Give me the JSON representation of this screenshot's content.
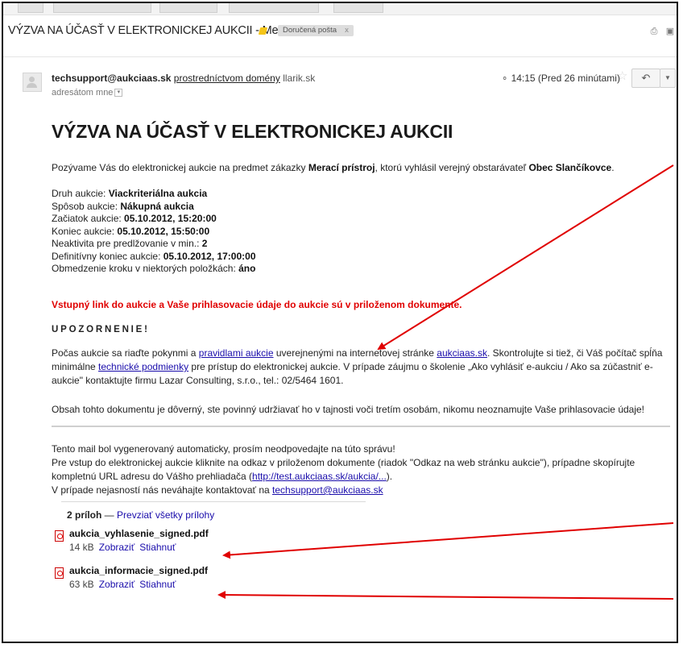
{
  "email": {
    "subject": "VÝZVA NA ÚČASŤ V ELEKTRONICKEJ AUKCII - Merací prístroj",
    "label": "Doručená pošta",
    "label_close": "x",
    "sender": "techsupport@aukciaas.sk",
    "via_text": "prostredníctvom domény",
    "via_domain": "llarik.sk",
    "recipient": "adresátom mne",
    "time": "14:15 (Pred 26 minútami)",
    "icons": {
      "print": "printer-icon",
      "newwindow": "new-window-icon",
      "star": "star-icon",
      "reply": "reply-icon",
      "more": "chevron-down-icon",
      "secure": "lock-icon"
    }
  },
  "body": {
    "heading": "VÝZVA NA ÚČASŤ V ELEKTRONICKEJ AUKCII",
    "intro_1": "Pozývame Vás do elektronickej aukcie na predmet zákazky ",
    "intro_subject": "Merací prístroj",
    "intro_2": ", ktorú vyhlásil verejný obstarávateľ ",
    "intro_org": "Obec Slančíkovce",
    "intro_3": ".",
    "details": [
      {
        "label": "Druh aukcie: ",
        "value": "Viackriteriálna aukcia"
      },
      {
        "label": "Spôsob aukcie: ",
        "value": "Nákupná aukcia"
      },
      {
        "label": "Začiatok aukcie: ",
        "value": "05.10.2012, 15:20:00"
      },
      {
        "label": "Koniec aukcie: ",
        "value": "05.10.2012, 15:50:00"
      },
      {
        "label": "Neaktivita pre predlžovanie v min.: ",
        "value": "2"
      },
      {
        "label": "Definitívny koniec aukcie: ",
        "value": "05.10.2012, 17:00:00"
      },
      {
        "label": "Obmedzenie kroku v niektorých položkách: ",
        "value": "áno"
      }
    ],
    "warning": "Vstupný link do aukcie a Vaše prihlasovacie údaje do aukcie sú v priloženom dokumente.",
    "notice_heading": "UPOZORNENIE!",
    "notice_1": "Počas aukcie sa riaďte pokynmi a ",
    "notice_link_rules": "pravidlami aukcie",
    "notice_2": " uverejnenými na internetovej stránke ",
    "notice_link_site": "aukciaas.sk",
    "notice_3": ". Skontrolujte si tiež, či Váš počítač spĺňa minimálne ",
    "notice_link_tech": "technické podmienky",
    "notice_4": " pre prístup do elektronickej aukcie. V prípade záujmu o školenie „Ako vyhlásiť e-aukciu / Ako sa zúčastniť e-aukcie\" kontaktujte firmu Lazar Consulting, s.r.o., tel.: 02/5464 1601.",
    "confidential": "Obsah tohto dokumentu je dôverný, ste povinný udržiavať ho v tajnosti voči tretím osobám, nikomu neoznamujte Vaše prihlasovacie údaje!",
    "auto_line": "Tento mail bol vygenerovaný automaticky, prosím neodpovedajte na túto správu!",
    "entry_1": "Pre vstup do elektronickej aukcie kliknite na odkaz v priloženom dokumente (riadok \"Odkaz na web stránku aukcie\"), prípadne skopírujte kompletnú URL adresu do Vášho prehliadača (",
    "entry_link": "http://test.aukciaas.sk/aukcia/...",
    "entry_2": ").",
    "contact_1": "V prípade nejasností nás neváhajte kontaktovať na ",
    "contact_link": "techsupport@aukciaas.sk"
  },
  "attachments": {
    "count_label": "2 príloh",
    "separator": " — ",
    "download_all": "Prevziať všetky prílohy",
    "items": [
      {
        "name": "aukcia_vyhlasenie_signed.pdf",
        "size": "14 kB",
        "view": "Zobraziť",
        "download": "Stiahnuť",
        "icon": "pdf-icon"
      },
      {
        "name": "aukcia_informacie_signed.pdf",
        "size": "63 kB",
        "view": "Zobraziť",
        "download": "Stiahnuť",
        "icon": "pdf-icon"
      }
    ]
  },
  "annotation": {
    "arrow_color": "#e00000"
  }
}
